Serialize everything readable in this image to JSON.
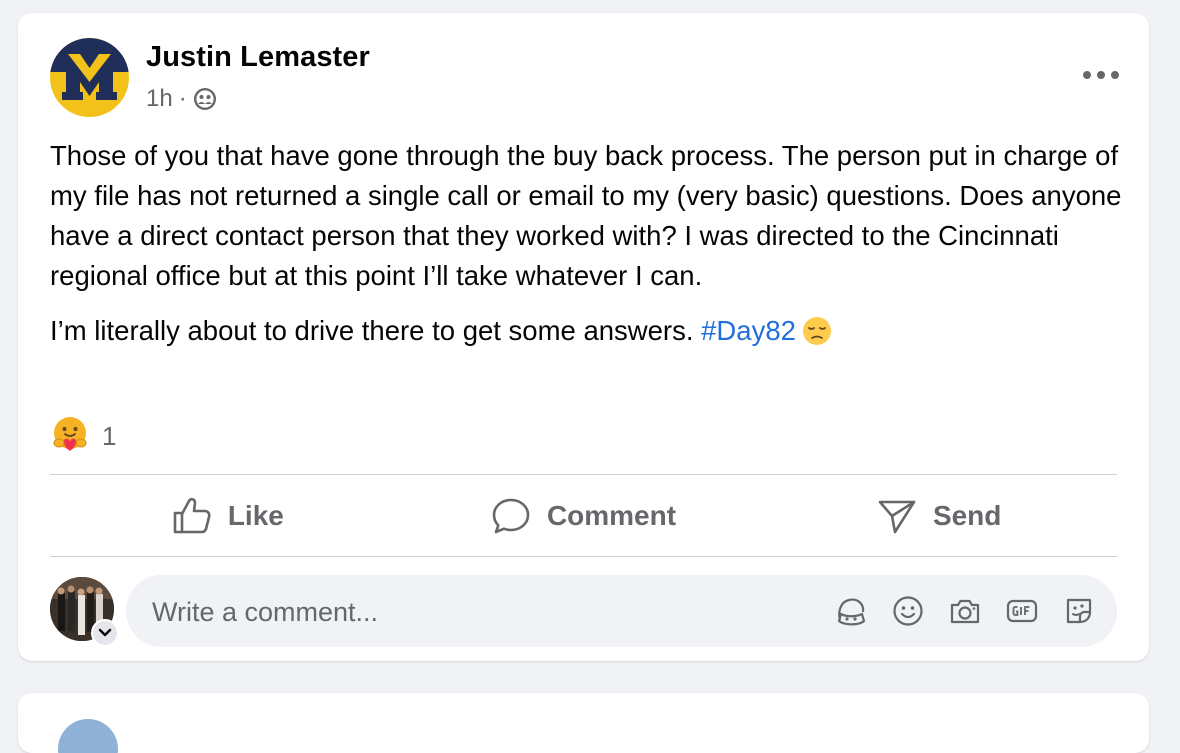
{
  "post": {
    "author": "Justin Lemaster",
    "time": "1h",
    "separator": "·",
    "audience_icon": "friends-icon",
    "paragraphs": [
      "Those of you that have gone through the buy back process. The person put in charge of my file has not returned a single call or email to my (very basic) questions. Does anyone have a direct contact person that they worked with? I was directed to the Cincinnati regional office but at this point I’ll take whatever I can."
    ],
    "last_paragraph_text": "I’m literally about to drive there to get some answers. ",
    "hashtag": "#Day82",
    "trailing_emoji": "pensive-face-emoji",
    "reaction_icon": "care-reaction-icon",
    "reaction_count": "1"
  },
  "actions": {
    "like_label": "Like",
    "comment_label": "Comment",
    "send_label": "Send"
  },
  "comment_composer": {
    "placeholder": "Write a comment...",
    "icons": [
      "avatar-sticker-icon",
      "emoji-icon",
      "camera-icon",
      "gif-icon",
      "sticker-icon"
    ]
  },
  "colors": {
    "background": "#f0f2f5",
    "card": "#ffffff",
    "secondary_text": "#65676b",
    "hashtag": "#216fdb",
    "logo_blue": "#1f2f5a",
    "logo_yellow": "#f2c21b"
  }
}
